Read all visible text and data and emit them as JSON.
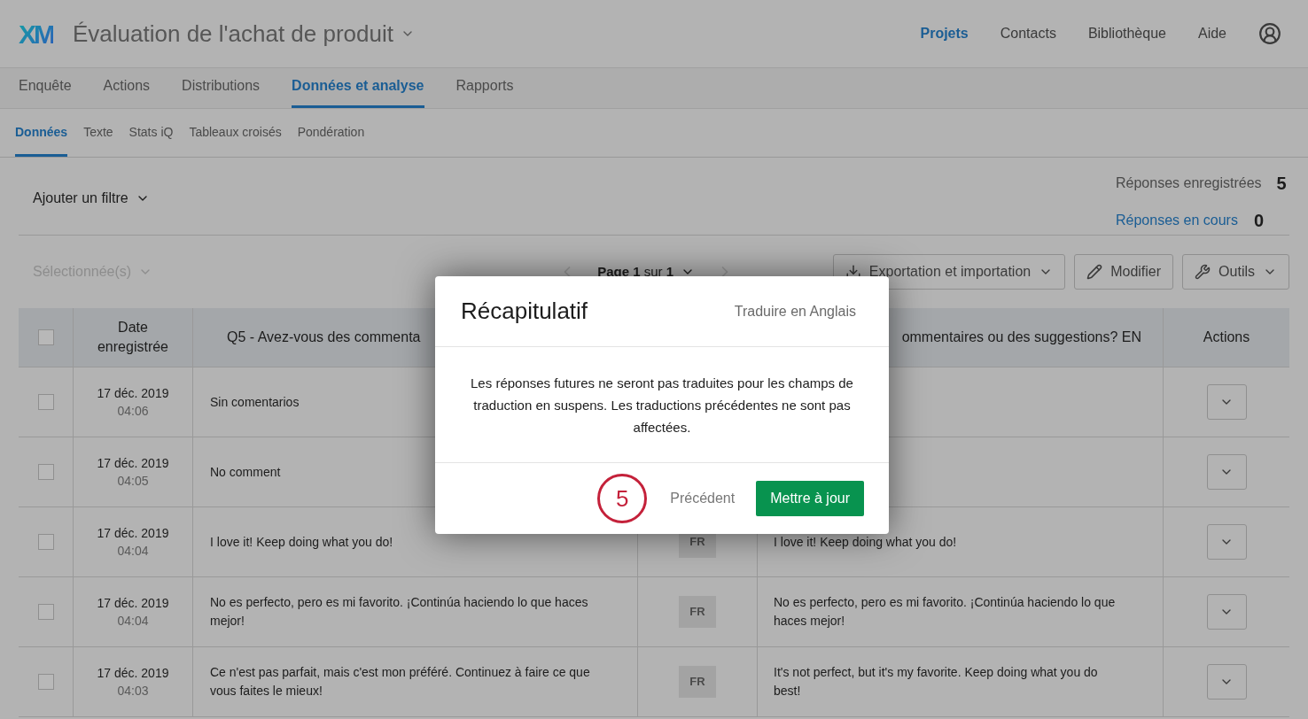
{
  "header": {
    "logo": "XM",
    "project_title": "Évaluation de l'achat de produit",
    "nav": [
      {
        "label": "Projets",
        "selected": true
      },
      {
        "label": "Contacts",
        "selected": false
      },
      {
        "label": "Bibliothèque",
        "selected": false
      },
      {
        "label": "Aide",
        "selected": false
      }
    ]
  },
  "tabs": [
    {
      "label": "Enquête",
      "selected": false
    },
    {
      "label": "Actions",
      "selected": false
    },
    {
      "label": "Distributions",
      "selected": false
    },
    {
      "label": "Données et analyse",
      "selected": true
    },
    {
      "label": "Rapports",
      "selected": false
    }
  ],
  "subtabs": [
    {
      "label": "Données",
      "selected": true
    },
    {
      "label": "Texte",
      "selected": false
    },
    {
      "label": "Stats iQ",
      "selected": false
    },
    {
      "label": "Tableaux croisés",
      "selected": false
    },
    {
      "label": "Pondération",
      "selected": false
    }
  ],
  "filter": {
    "label": "Ajouter un filtre"
  },
  "stats": [
    {
      "label": "Réponses enregistrées",
      "value": "5",
      "kind": "plain"
    },
    {
      "label": "Réponses en cours",
      "value": "0",
      "kind": "link"
    }
  ],
  "toolbar": {
    "selection": {
      "label": "Sélectionnée(s)",
      "disabled": true
    },
    "pager": "**Page 1** sur **1**",
    "buttons": [
      {
        "label": "Exportation et importation",
        "kind": "download",
        "dropdown": true
      },
      {
        "label": "Modifier",
        "kind": "edit",
        "dropdown": false
      },
      {
        "label": "Outils",
        "kind": "tools",
        "dropdown": true
      }
    ]
  },
  "table": {
    "header_checked": false,
    "columns": [
      "Date enregistrée",
      "Q5 - Avez-vous des commenta",
      "ommentaires ou des suggestions? EN",
      "Actions"
    ],
    "rows": [
      {
        "checked": false,
        "date": "17 déc. 2019",
        "time": "04:06",
        "q5": "Sin comentarios"
      },
      {
        "checked": false,
        "date": "17 déc. 2019",
        "time": "04:05",
        "q5": "No comment"
      },
      {
        "checked": false,
        "date": "17 déc. 2019",
        "time": "04:04",
        "q5": "I love it! Keep doing what you do!",
        "language": "FR",
        "en": "I love it! Keep doing what you do!"
      },
      {
        "checked": false,
        "date": "17 déc. 2019",
        "time": "04:04",
        "q5": "No es perfecto, pero es mi favorito. ¡Continúa haciendo lo que haces mejor!",
        "language": "FR",
        "en": "No es perfecto, pero es mi favorito. ¡Continúa haciendo lo que haces mejor!"
      },
      {
        "checked": false,
        "date": "17 déc. 2019",
        "time": "04:03",
        "q5": "Ce n'est pas parfait, mais c'est mon préféré. Continuez à faire ce que vous faites le mieux!",
        "language": "FR",
        "en": "It's not perfect, but it's my favorite. Keep doing what you do best!"
      }
    ]
  },
  "modal": {
    "title": "Récapitulatif",
    "step_label": "Traduire en Anglais",
    "message": "Les réponses futures ne seront pas traduites pour les champs de traduction en suspens. Les traductions précédentes ne sont pas affectées.",
    "callout": "5",
    "back": "Précédent",
    "primary": "Mettre à jour"
  }
}
